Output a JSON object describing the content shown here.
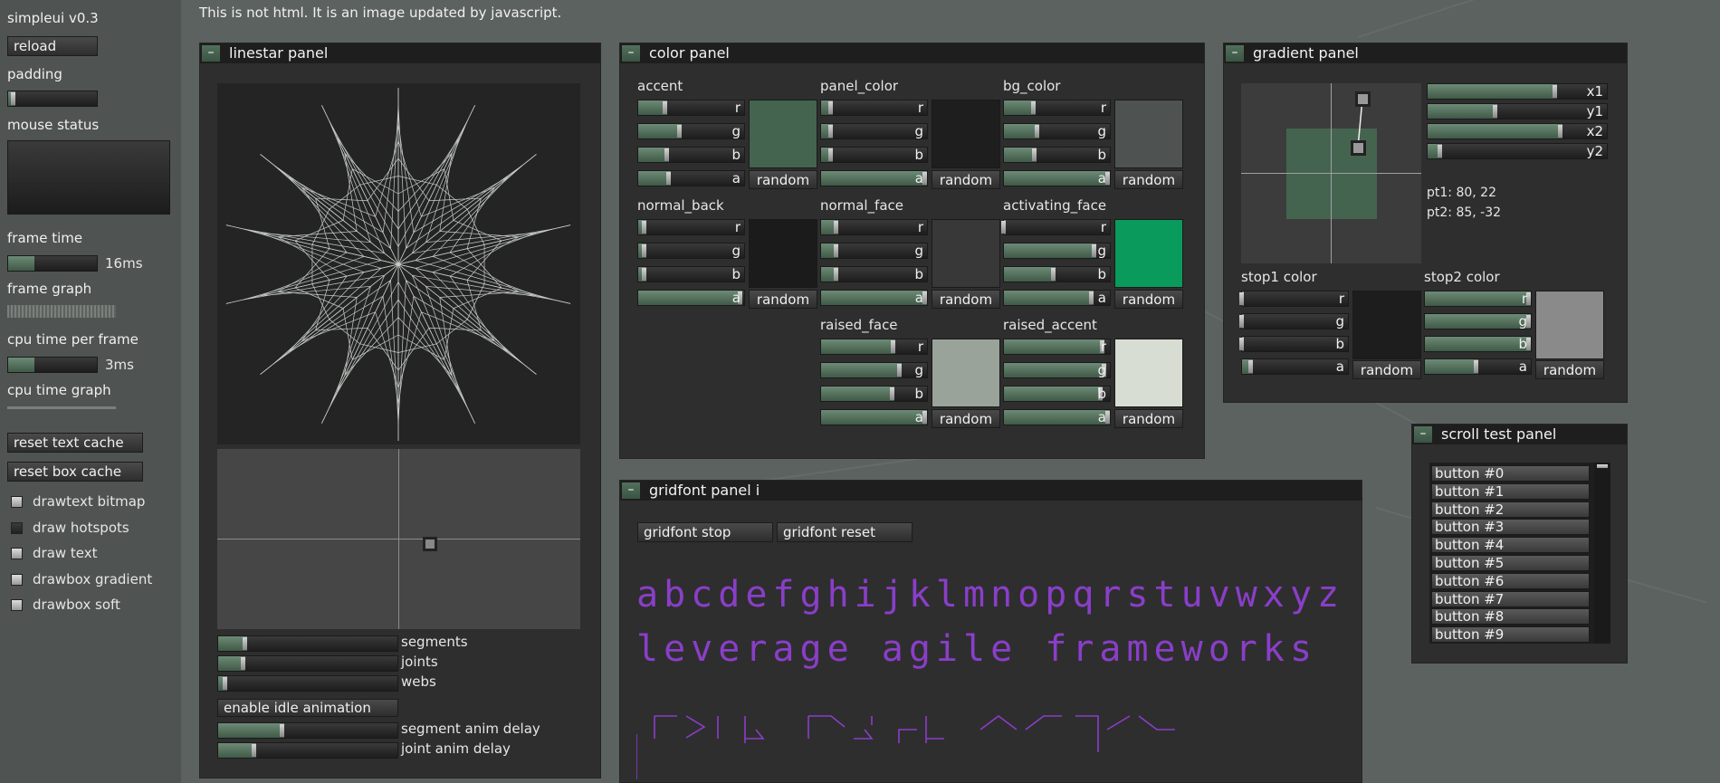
{
  "app": {
    "version_title": "simpleui v0.3",
    "notice": "This is not html. It is an image updated by javascript."
  },
  "sidebar": {
    "reload_label": "reload",
    "padding_label": "padding",
    "padding_value": 0.08,
    "mouse_status_label": "mouse status",
    "frame_time_label": "frame time",
    "frame_time_value": "16ms",
    "frame_time_level": 0.3,
    "frame_graph_label": "frame graph",
    "cpu_time_label": "cpu time per frame",
    "cpu_time_value": "3ms",
    "cpu_time_level": 0.3,
    "cpu_graph_label": "cpu time graph",
    "reset_text_cache_label": "reset text cache",
    "reset_box_cache_label": "reset box cache",
    "checkboxes": [
      {
        "label": "drawtext bitmap",
        "checked": true
      },
      {
        "label": "draw hotspots",
        "checked": false
      },
      {
        "label": "draw text",
        "checked": true
      },
      {
        "label": "drawbox gradient",
        "checked": true
      },
      {
        "label": "drawbox soft",
        "checked": true
      }
    ]
  },
  "linestar_panel": {
    "title": "linestar panel",
    "minimize_label": "–",
    "sliders": [
      {
        "label": "segments",
        "level": 0.16
      },
      {
        "label": "joints",
        "level": 0.15
      },
      {
        "label": "webs",
        "level": 0.05
      }
    ],
    "idle_button_label": "enable idle animation",
    "anim_sliders": [
      {
        "label": "segment anim delay",
        "level": 0.37
      },
      {
        "label": "joint anim delay",
        "level": 0.21
      }
    ]
  },
  "color_panel": {
    "title": "color panel",
    "minimize_label": "–",
    "random_label": "random",
    "channel_labels": [
      "r",
      "g",
      "b",
      "a"
    ],
    "groups": [
      {
        "name": "accent",
        "channels": [
          0.27,
          0.41,
          0.29,
          0.31
        ],
        "alpha": 0.31,
        "color": "#44644f"
      },
      {
        "name": "panel_color",
        "channels": [
          0.11,
          0.11,
          0.11,
          1.0
        ],
        "color": "#1e1e1e"
      },
      {
        "name": "bg_color",
        "channels": [
          0.3,
          0.33,
          0.31,
          1.0
        ],
        "color": "#4e5352"
      },
      {
        "name": "normal_back",
        "channels": [
          0.08,
          0.08,
          0.08,
          0.98
        ],
        "color": "#1b1b1b"
      },
      {
        "name": "normal_face",
        "channels": [
          0.16,
          0.16,
          0.16,
          1.0
        ],
        "color": "#383838"
      },
      {
        "name": "activating_face",
        "channels": [
          0.02,
          0.87,
          0.49,
          0.85
        ],
        "color": "#0a9a5c"
      },
      {
        "name": "raised_face",
        "channels": [
          0.7,
          0.76,
          0.69,
          1.0
        ],
        "color": "#9aa39a"
      },
      {
        "name": "raised_accent",
        "channels": [
          0.95,
          0.97,
          0.93,
          1.0
        ],
        "color": "#d8ddd3"
      }
    ]
  },
  "gradient_panel": {
    "title": "gradient panel",
    "minimize_label": "–",
    "sliders": [
      {
        "label": "x1",
        "level": 0.72
      },
      {
        "label": "y1",
        "level": 0.39
      },
      {
        "label": "x2",
        "level": 0.75
      },
      {
        "label": "y2",
        "level": 0.08
      }
    ],
    "pt1": "pt1: 80, 22",
    "pt2": "pt2: 85, -32",
    "stop1": {
      "label": "stop1 color",
      "channels": [
        0.02,
        0.02,
        0.02,
        0.1
      ],
      "color": "#1d1d1d"
    },
    "stop2": {
      "label": "stop2 color",
      "channels": [
        1.0,
        1.0,
        1.0,
        0.5
      ],
      "color": "#8a8a8a"
    },
    "random_label": "random"
  },
  "scroll_panel": {
    "title": "scroll test panel",
    "minimize_label": "–",
    "buttons": [
      "button #0",
      "button #1",
      "button #2",
      "button #3",
      "button #4",
      "button #5",
      "button #6",
      "button #7",
      "button #8",
      "button #9"
    ]
  },
  "gridfont_panel": {
    "title": "gridfont panel i",
    "minimize_label": "–",
    "stop_label": "gridfont stop",
    "reset_label": "gridfont reset",
    "lines": [
      "abcdefghijklmnopqrstuvwxyz",
      "leverage agile frameworks"
    ],
    "glyph_color": "#8a3ec9"
  },
  "colors": {
    "accent": "#44644f",
    "background": "#5c625f",
    "panel": "#2e2e2e"
  }
}
